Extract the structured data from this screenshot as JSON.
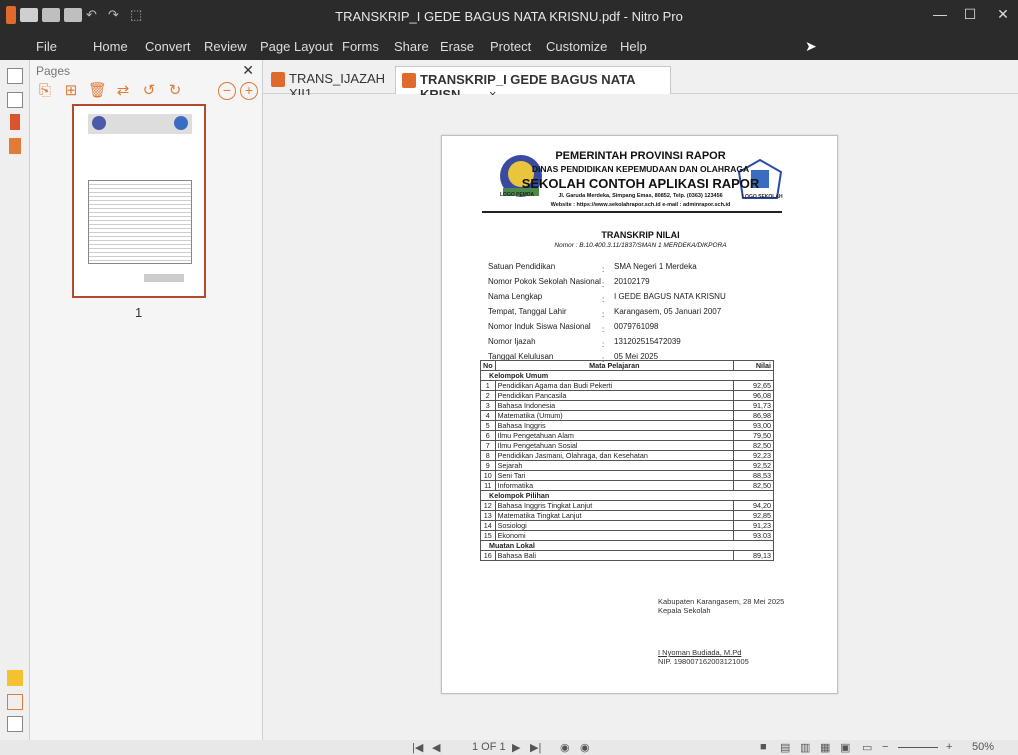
{
  "window": {
    "title": "TRANSKRIP_I GEDE BAGUS NATA KRISNU.pdf - Nitro Pro"
  },
  "menu": [
    "File",
    "Home",
    "Convert",
    "Review",
    "Page Layout",
    "Forms",
    "Share",
    "Erase",
    "Protect",
    "Customize",
    "Help"
  ],
  "pages_panel": {
    "title": "Pages",
    "thumb_label": "1"
  },
  "tabs": [
    {
      "label": "TRANS_IJAZAH XII1"
    },
    {
      "label": "TRANSKRIP_I GEDE BAGUS NATA KRISN...",
      "close": "×"
    }
  ],
  "doc": {
    "header1": "PEMERINTAH PROVINSI RAPOR",
    "header2": "DINAS PENDIDIKAN KEPEMUDAAN DAN OLAHRAGA",
    "header3": "SEKOLAH CONTOH APLIKASI RAPOR",
    "header4": "Jl. Garuda Merdeka, Simpang Emas, 80852, Telp. (0363) 123456",
    "header5": "Website : https://www.sekolahrapor.sch.id  e-mail : adminrapor.sch.id",
    "logo_left": "LOGO PEMDA",
    "logo_right": "LOGO SEKOLAH",
    "title": "TRANSKRIP NILAI",
    "nomor": "Nomor : B.10.400.3.11/1837/SMAN 1 MERDEKA/DIKPORA",
    "fields": [
      {
        "label": "Satuan Pendidikan",
        "value": "SMA Negeri 1 Merdeka"
      },
      {
        "label": "Nomor Pokok Sekolah Nasional",
        "value": "20102179"
      },
      {
        "label": "Nama Lengkap",
        "value": "I GEDE BAGUS NATA KRISNU"
      },
      {
        "label": "Tempat, Tanggal Lahir",
        "value": "Karangasem, 05 Januari 2007"
      },
      {
        "label": "Nomor Induk Siswa Nasional",
        "value": "0079761098"
      },
      {
        "label": "Nomor Ijazah",
        "value": "131202515472039"
      },
      {
        "label": "Tanggal Kelulusan",
        "value": "05 Mei 2025"
      }
    ],
    "table_headers": {
      "no": "No",
      "subject": "Mata Pelajaran",
      "grade": "Nilai"
    },
    "groups": [
      {
        "name": "Kelompok Umum",
        "rows": [
          {
            "no": "1",
            "subject": "Pendidikan Agama dan Budi Pekerti",
            "grade": "92,65"
          },
          {
            "no": "2",
            "subject": "Pendidikan Pancasila",
            "grade": "96,08"
          },
          {
            "no": "3",
            "subject": "Bahasa Indonesia",
            "grade": "91,73"
          },
          {
            "no": "4",
            "subject": "Matematika (Umum)",
            "grade": "86,98"
          },
          {
            "no": "5",
            "subject": "Bahasa Inggris",
            "grade": "93,00"
          },
          {
            "no": "6",
            "subject": "Ilmu Pengetahuan Alam",
            "grade": "79,50"
          },
          {
            "no": "7",
            "subject": "Ilmu Pengetahuan Sosial",
            "grade": "82,50"
          },
          {
            "no": "8",
            "subject": "Pendidikan Jasmani, Olahraga, dan Kesehatan",
            "grade": "92,23"
          },
          {
            "no": "9",
            "subject": "Sejarah",
            "grade": "92,52"
          },
          {
            "no": "10",
            "subject": "Seni Tari",
            "grade": "88,53"
          },
          {
            "no": "11",
            "subject": "Informatika",
            "grade": "82,50"
          }
        ]
      },
      {
        "name": "Kelompok Pilihan",
        "rows": [
          {
            "no": "12",
            "subject": "Bahasa Inggris Tingkat Lanjut",
            "grade": "94,20"
          },
          {
            "no": "13",
            "subject": "Matematika Tingkat Lanjut",
            "grade": "92,85"
          },
          {
            "no": "14",
            "subject": "Sosiologi",
            "grade": "91,23"
          },
          {
            "no": "15",
            "subject": "Ekonomi",
            "grade": "93.03"
          }
        ]
      },
      {
        "name": "Muatan Lokal",
        "rows": [
          {
            "no": "16",
            "subject": "Bahasa Bali",
            "grade": "89,13"
          }
        ]
      }
    ],
    "place_date": "Kabupaten Karangasem, 28 Mei 2025",
    "position": "Kepala Sekolah",
    "signer": "I Nyoman Budiada, M.Pd",
    "nip": "NIP. 198007162003121005"
  },
  "status": {
    "page": "1 OF 1",
    "zoom": "50%"
  },
  "colors": {
    "accent": "#e07b39",
    "titlebar": "#2b2b2b"
  }
}
